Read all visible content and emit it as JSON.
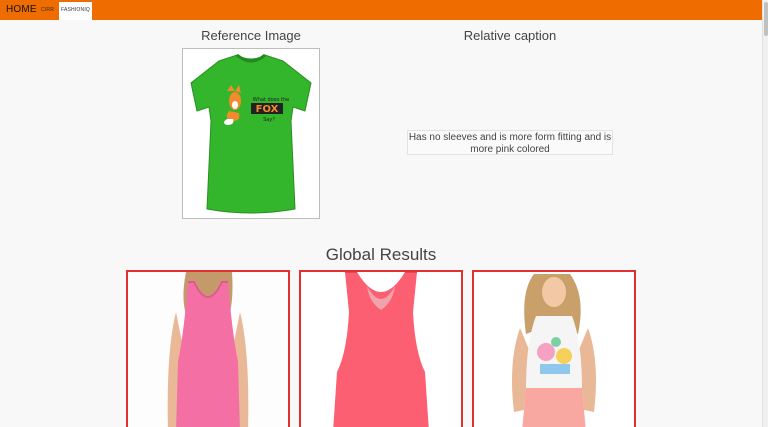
{
  "navbar": {
    "brand": "HOME",
    "links": [
      "CIRR",
      "FASHIONIQ"
    ],
    "active": "FASHIONIQ",
    "color": "#ef6c00"
  },
  "reference": {
    "title": "Reference Image",
    "shirt_text": [
      "What does the",
      "FOX",
      "Say?"
    ],
    "shirt_color": "#33b52c"
  },
  "relative": {
    "title": "Relative caption",
    "caption": "Has no sleeves and is more form fitting and is more pink colored"
  },
  "global": {
    "title": "Global Results",
    "border_color": "#e03030",
    "results": [
      {
        "kind": "pink tank top"
      },
      {
        "kind": "coral racerback tank top"
      },
      {
        "kind": "graphic tank top with pink shorts"
      }
    ]
  }
}
